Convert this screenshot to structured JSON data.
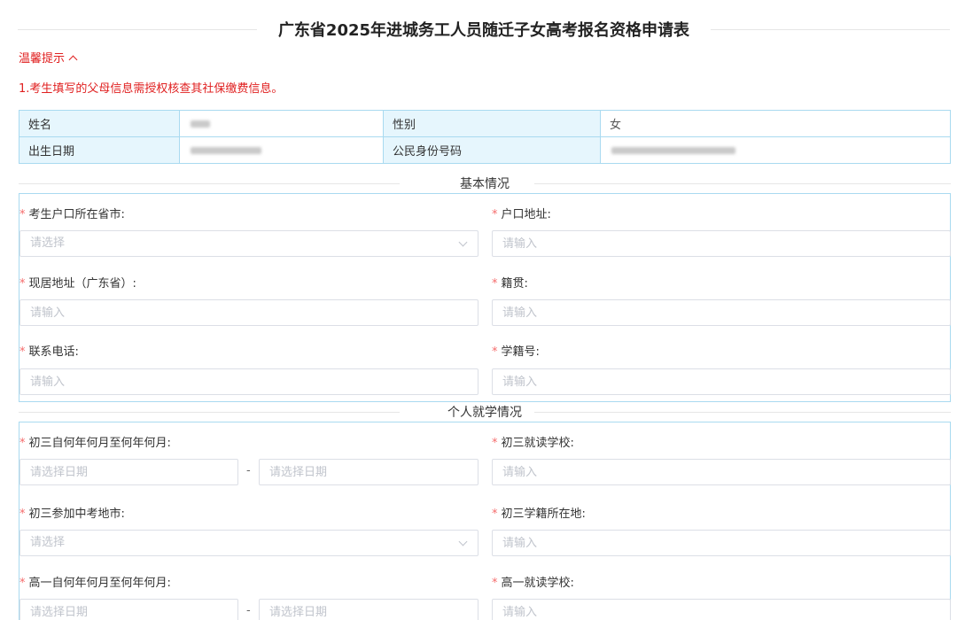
{
  "title": "广东省2025年进城务工人员随迁子女高考报名资格申请表",
  "tips": {
    "toggle_label": "温馨提示",
    "items": [
      "1.考生填写的父母信息需授权核查其社保缴费信息。"
    ]
  },
  "info": {
    "name_label": "姓名",
    "gender_label": "性别",
    "gender_value": "女",
    "birth_label": "出生日期",
    "id_label": "公民身份号码"
  },
  "basic": {
    "section_title": "基本情况",
    "hukou_province_label": "考生户口所在省市:",
    "hukou_province_placeholder": "请选择",
    "hukou_address_label": "户口地址:",
    "hukou_address_placeholder": "请输入",
    "current_address_label": "现居地址（广东省）:",
    "current_address_placeholder": "请输入",
    "native_place_label": "籍贯:",
    "native_place_placeholder": "请输入",
    "phone_label": "联系电话:",
    "phone_placeholder": "请输入",
    "student_no_label": "学籍号:",
    "student_no_placeholder": "请输入"
  },
  "study": {
    "section_title": "个人就学情况",
    "grade9_period_label": "初三自何年何月至何年何月:",
    "grade9_start_placeholder": "请选择日期",
    "grade9_end_placeholder": "请选择日期",
    "range_separator": "-",
    "grade9_school_label": "初三就读学校:",
    "grade9_school_placeholder": "请输入",
    "zhongkao_city_label": "初三参加中考地市:",
    "zhongkao_city_placeholder": "请选择",
    "grade9_registry_label": "初三学籍所在地:",
    "grade9_registry_placeholder": "请输入",
    "grade10_period_label": "高一自何年何月至何年何月:",
    "grade10_start_placeholder": "请选择日期",
    "grade10_end_placeholder": "请选择日期",
    "grade10_school_label": "高一就读学校:",
    "grade10_school_placeholder": "请输入"
  },
  "required_mark": "*"
}
